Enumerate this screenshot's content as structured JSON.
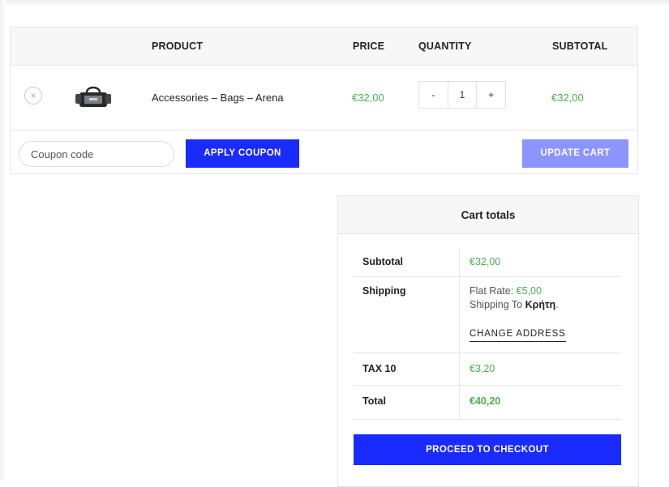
{
  "cart": {
    "headers": {
      "product": "PRODUCT",
      "price": "PRICE",
      "quantity": "QUANTITY",
      "subtotal": "SUBTOTAL"
    },
    "items": [
      {
        "remove_icon": "×",
        "name": "Accessories – Bags – Arena",
        "price": "€32,00",
        "qty_minus": "-",
        "quantity": "1",
        "qty_plus": "+",
        "subtotal": "€32,00"
      }
    ],
    "coupon": {
      "placeholder": "Coupon code",
      "value": ""
    },
    "apply_coupon_label": "APPLY COUPON",
    "update_cart_label": "UPDATE CART"
  },
  "totals": {
    "title": "Cart totals",
    "subtotal_label": "Subtotal",
    "subtotal_value": "€32,00",
    "shipping_label": "Shipping",
    "shipping_method_prefix": "Flat Rate: ",
    "shipping_method_price": "€5,00",
    "shipping_to_prefix": "Shipping To ",
    "shipping_to_region": "Κρήτη",
    "shipping_to_suffix": ".",
    "change_address_label": "CHANGE ADDRESS",
    "tax_label": "TAX 10",
    "tax_value": "€3,20",
    "total_label": "Total",
    "total_value": "€40,20",
    "checkout_label": "PROCEED TO CHECKOUT"
  },
  "colors": {
    "primary_button": "#1a2bff",
    "disabled_button": "#8c95ff",
    "price_green": "#4caf50",
    "header_bg": "#f7f7f7"
  },
  "icons": {
    "remove": "close-circle-icon",
    "product_thumbnail": "bag-product-image"
  }
}
